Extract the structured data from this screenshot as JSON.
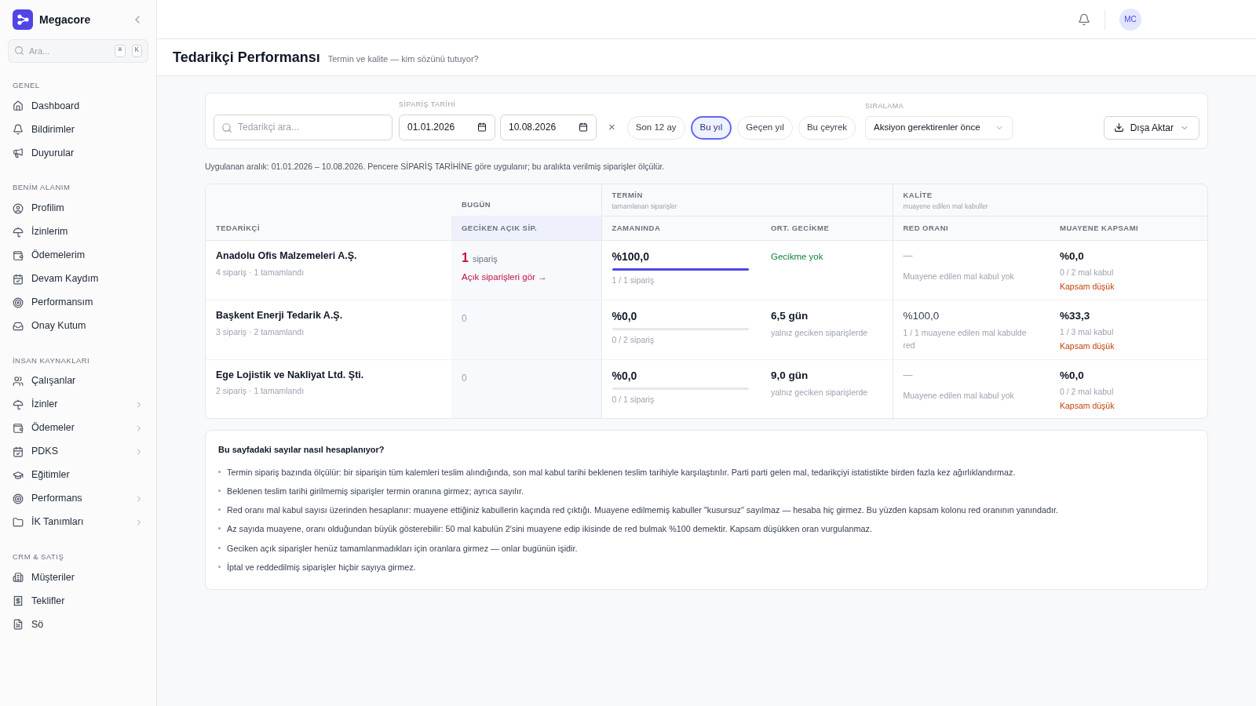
{
  "brand": {
    "name": "Megacore"
  },
  "sidebar_search": {
    "placeholder": "Ara...",
    "keys": [
      "⌘",
      "K"
    ]
  },
  "sidebar": [
    {
      "title": "GENEL",
      "items": [
        {
          "label": "Dashboard",
          "has_submenu": false
        },
        {
          "label": "Bildirimler",
          "has_submenu": false
        },
        {
          "label": "Duyurular",
          "has_submenu": false
        }
      ]
    },
    {
      "title": "BENİM ALANIM",
      "items": [
        {
          "label": "Profilim",
          "has_submenu": false
        },
        {
          "label": "İzinlerim",
          "has_submenu": false
        },
        {
          "label": "Ödemelerim",
          "has_submenu": false
        },
        {
          "label": "Devam Kaydım",
          "has_submenu": false
        },
        {
          "label": "Performansım",
          "has_submenu": false
        },
        {
          "label": "Onay Kutum",
          "has_submenu": false
        }
      ]
    },
    {
      "title": "İNSAN KAYNAKLARI",
      "items": [
        {
          "label": "Çalışanlar",
          "has_submenu": false
        },
        {
          "label": "İzinler",
          "has_submenu": true
        },
        {
          "label": "Ödemeler",
          "has_submenu": true
        },
        {
          "label": "PDKS",
          "has_submenu": true
        },
        {
          "label": "Eğitimler",
          "has_submenu": false
        },
        {
          "label": "Performans",
          "has_submenu": true
        },
        {
          "label": "İK Tanımları",
          "has_submenu": true
        }
      ]
    },
    {
      "title": "CRM & SATIŞ",
      "items": [
        {
          "label": "Müşteriler",
          "has_submenu": false
        },
        {
          "label": "Teklifler",
          "has_submenu": false
        },
        {
          "label": "Sö",
          "has_submenu": false
        }
      ]
    }
  ],
  "user": {
    "initials": "MC"
  },
  "page": {
    "title": "Tedarikçi Performansı",
    "subtitle": "Termin ve kalite — kim sözünü tutuyor?"
  },
  "filters": {
    "search_placeholder": "Tedarikçi ara...",
    "date_label": "SİPARİŞ TARİHİ",
    "date_from": "01.01.2026",
    "date_to": "10.08.2026",
    "clear": "×",
    "presets": [
      {
        "label": "Son 12 ay",
        "selected": false
      },
      {
        "label": "Bu yıl",
        "selected": true
      },
      {
        "label": "Geçen yıl",
        "selected": false
      },
      {
        "label": "Bu çeyrek",
        "selected": false
      }
    ],
    "sort_label": "SIRALAMA",
    "sort_value": "Aksiyon gerektirenler önce",
    "export": "Dışa Aktar"
  },
  "range_note": "Uygulanan aralık: 01.01.2026 – 10.08.2026. Pencere SİPARİŞ TARİHİNE göre uygulanır; bu aralıkta verilmiş siparişler ölçülür.",
  "table": {
    "groups": [
      {
        "title": "BUGÜN"
      },
      {
        "title": "TERMİN",
        "sub": "tamamlanan siparişler"
      },
      {
        "title": "KALİTE",
        "sub": "muayene edilen mal kabuller"
      }
    ],
    "columns": [
      "TEDARİKÇİ",
      "GECİKEN AÇIK SİP.",
      "ZAMANINDA",
      "ORT. GECİKME",
      "RED ORANI",
      "MUAYENE KAPSAMI"
    ],
    "rows": [
      {
        "name": "Anadolu Ofis Malzemeleri A.Ş.",
        "sub": "4 sipariş · 1 tamamlandı",
        "late": {
          "overdue": true,
          "count": "1",
          "unit": "sipariş",
          "link": "Açık siparişleri gör →"
        },
        "ontime": {
          "value": "%100,0",
          "level": 1,
          "sub": "1 / 1 sipariş"
        },
        "delay": {
          "kind": "ok",
          "value": "Gecikme yok"
        },
        "reject": {
          "kind": "empty",
          "value": "—",
          "sub": "Muayene edilen mal kabul yok"
        },
        "coverage": {
          "value": "%0,0",
          "sub": "0 / 2 mal kabul",
          "warning": "Kapsam düşük"
        }
      },
      {
        "name": "Başkent Enerji Tedarik A.Ş.",
        "sub": "3 sipariş · 2 tamamlandı",
        "late": {
          "overdue": false,
          "count": "0"
        },
        "ontime": {
          "value": "%0,0",
          "level": 0,
          "sub": "0 / 2 sipariş"
        },
        "delay": {
          "kind": "days",
          "value": "6,5 gün",
          "sub": "yalnız geciken siparişlerde"
        },
        "reject": {
          "kind": "value",
          "value": "%100,0",
          "sub": "1 / 1 muayene edilen mal kabulde red"
        },
        "coverage": {
          "value": "%33,3",
          "sub": "1 / 3 mal kabul",
          "warning": "Kapsam düşük"
        }
      },
      {
        "name": "Ege Lojistik ve Nakliyat Ltd. Şti.",
        "sub": "2 sipariş · 1 tamamlandı",
        "late": {
          "overdue": false,
          "count": "0"
        },
        "ontime": {
          "value": "%0,0",
          "level": 0,
          "sub": "0 / 1 sipariş"
        },
        "delay": {
          "kind": "days",
          "value": "9,0 gün",
          "sub": "yalnız geciken siparişlerde"
        },
        "reject": {
          "kind": "empty",
          "value": "—",
          "sub": "Muayene edilen mal kabul yok"
        },
        "coverage": {
          "value": "%0,0",
          "sub": "0 / 2 mal kabul",
          "warning": "Kapsam düşük"
        }
      }
    ]
  },
  "help": {
    "title": "Bu sayfadaki sayılar nasıl hesaplanıyor?",
    "items": [
      "Termin sipariş bazında ölçülür: bir siparişin tüm kalemleri teslim alındığında, son mal kabul tarihi beklenen teslim tarihiyle karşılaştırılır. Parti parti gelen mal, tedarikçiyi istatistikte birden fazla kez ağırlıklandırmaz.",
      "Beklenen teslim tarihi girilmemiş siparişler termin oranına girmez; ayrıca sayılır.",
      "Red oranı mal kabul sayısı üzerinden hesaplanır: muayene ettiğiniz kabullerin kaçında red çıktığı. Muayene edilmemiş kabuller \"kusursuz\" sayılmaz — hesaba hiç girmez. Bu yüzden kapsam kolonu red oranının yanındadır.",
      "Az sayıda muayene, oranı olduğundan büyük gösterebilir: 50 mal kabulün 2'sini muayene edip ikisinde de red bulmak %100 demektir. Kapsam düşükken oran vurgulanmaz.",
      "Geciken açık siparişler henüz tamamlanmadıkları için oranlara girmez — onlar bugünün işidir.",
      "İptal ve reddedilmiş siparişler hiçbir sayıya girmez."
    ]
  }
}
